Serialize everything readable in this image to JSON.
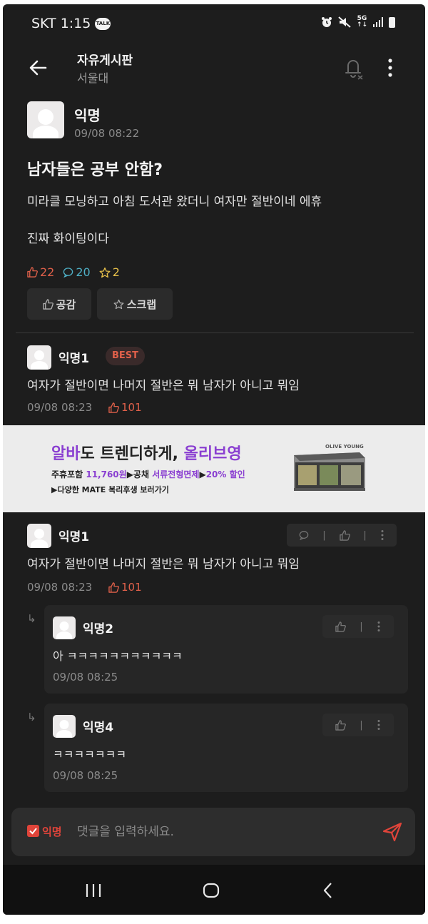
{
  "status_bar": {
    "carrier_time": "SKT 1:15",
    "talk_badge": "TALK",
    "network": "5G"
  },
  "app_bar": {
    "title": "자유게시판",
    "subtitle": "서울대"
  },
  "post": {
    "author": "익명",
    "time": "09/08 08:22",
    "title": "남자들은 공부 안함?",
    "body_line1": "미라클 모닝하고 아침 도서관 왔더니 여자만 절반이네 에휴",
    "body_line2": "진짜 화이팅이다",
    "likes": "22",
    "comments": "20",
    "scraps": "2",
    "like_button_label": "공감",
    "scrap_button_label": "스크랩"
  },
  "best_comment": {
    "author": "익명1",
    "badge": "BEST",
    "text": "여자가 절반이면 나머지 절반은 뭐 남자가 아니고 뭐임",
    "time": "09/08 08:23",
    "likes": "101"
  },
  "ad": {
    "title_part1": "알바",
    "title_part2": "도 트렌디하게, ",
    "title_part3": "올리브영",
    "line2_a": "주휴포함 ",
    "line2_b": "11,760원",
    "line2_c": "▶공채 ",
    "line2_d": "서류전형면제",
    "line2_e": "▶",
    "line2_f": "20% 할인",
    "line3": "▶다양한 MATE 복리후생 보러가기",
    "logo_text": "OLIVE YOUNG"
  },
  "comments": [
    {
      "author": "익명1",
      "text": "여자가 절반이면 나머지 절반은 뭐 남자가 아니고 뭐임",
      "time": "09/08 08:23",
      "likes": "101"
    }
  ],
  "replies": [
    {
      "author": "익명2",
      "text": "아 ㅋㅋㅋㅋㅋㅋㅋㅋㅋㅋㅋ",
      "time": "09/08 08:25",
      "arrow": "↳"
    },
    {
      "author": "익명4",
      "text": "ㅋㅋㅋㅋㅋㅋㅋ",
      "time": "09/08 08:25",
      "arrow": "↳"
    }
  ],
  "composer": {
    "anon_label": "익명",
    "placeholder": "댓글을 입력하세요."
  },
  "colors": {
    "background": "#1d1d1d",
    "accent_red": "#e0443a",
    "like_orange": "#e0604a",
    "comment_teal": "#4fb0c6",
    "scrap_yellow": "#e8c14a",
    "ad_purple": "#8a3fd1"
  },
  "icons": [
    "back-arrow-icon",
    "bell-off-icon",
    "more-vert-icon",
    "thumbs-up-icon",
    "comment-icon",
    "star-icon",
    "send-icon",
    "recent-apps-icon",
    "home-icon",
    "nav-back-icon"
  ]
}
